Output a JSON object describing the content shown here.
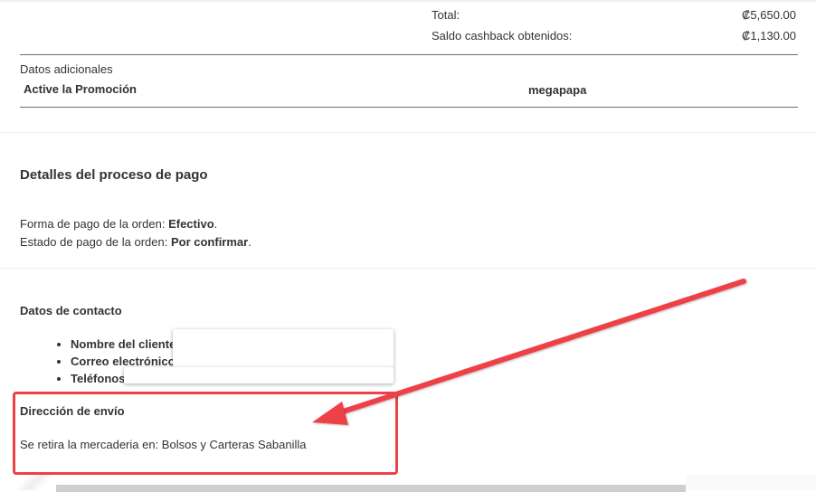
{
  "summary": {
    "total_label": "Total:",
    "total_value": "₡5,650.00",
    "cashback_label": "Saldo cashback obtenidos:",
    "cashback_value": "₡1,130.00"
  },
  "additional": {
    "title": "Datos adicionales",
    "row_label": "Active la Promoción",
    "row_value": "megapapa"
  },
  "payment": {
    "title": "Detalles del proceso de pago",
    "method_prefix": "Forma de pago de la orden: ",
    "method_value": "Efectivo",
    "status_prefix": "Estado de pago de la orden: ",
    "status_value": "Por confirmar"
  },
  "contact": {
    "title": "Datos de contacto",
    "name_label": "Nombre del cliente:",
    "email_label": "Correo electrónico:",
    "phone_label": "Teléfonos"
  },
  "shipping": {
    "title": "Dirección de envío",
    "text": "Se retira la mercaderia en: Bolsos y Carteras Sabanilla"
  },
  "annotation": {
    "color": "#ee4046"
  }
}
